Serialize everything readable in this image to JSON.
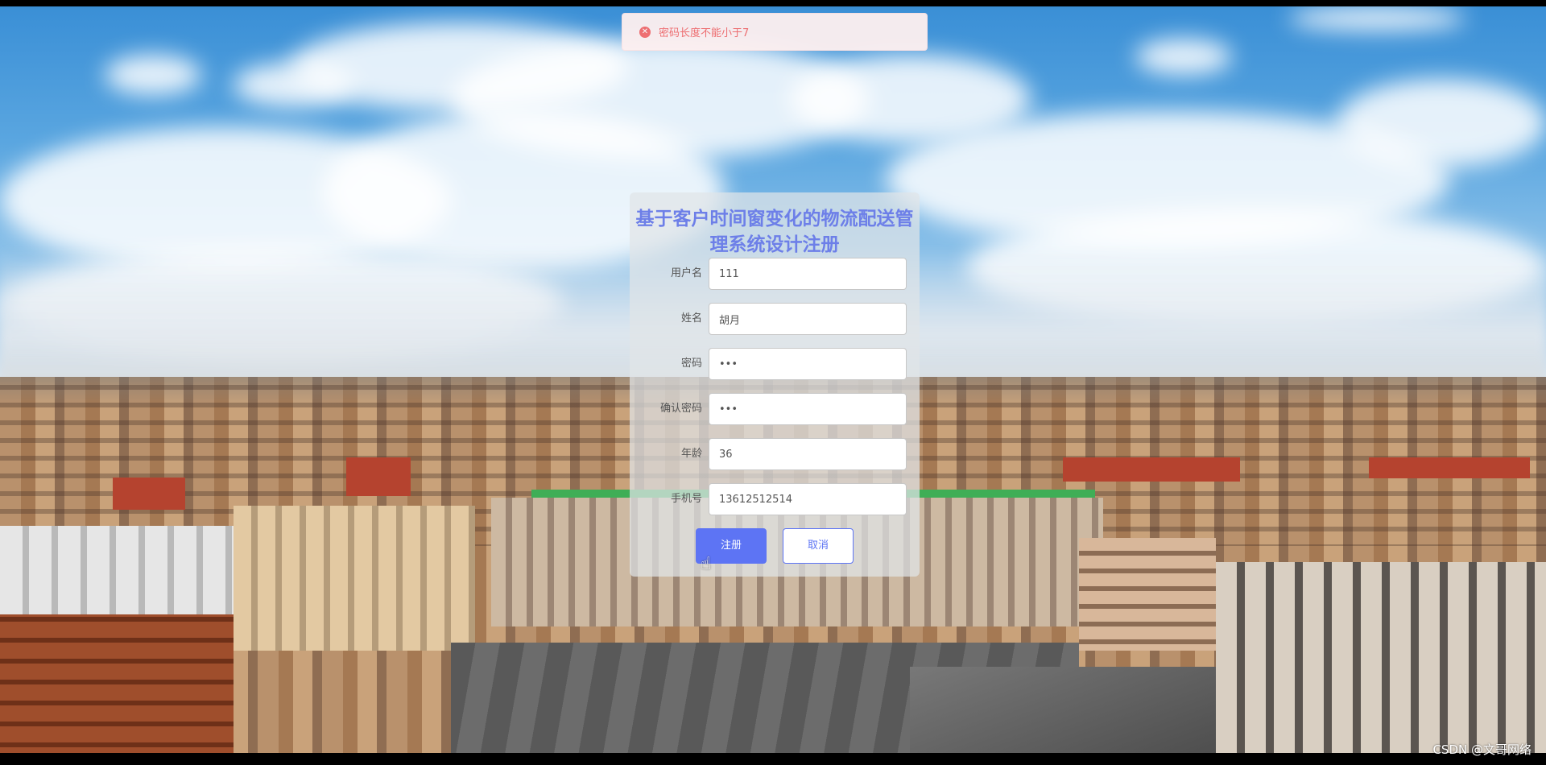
{
  "toast": {
    "icon": "error-circle-icon",
    "message": "密码长度不能小于7",
    "color": "#f56c6c"
  },
  "register": {
    "title": "基于客户时间窗变化的物流配送管理系统设计注册",
    "fields": [
      {
        "label": "用户名",
        "value": "111"
      },
      {
        "label": "姓名",
        "value": "胡月"
      },
      {
        "label": "密码",
        "value": "•••"
      },
      {
        "label": "确认密码",
        "value": "•••"
      },
      {
        "label": "年龄",
        "value": "36"
      },
      {
        "label": "手机号",
        "value": "13612512514"
      }
    ],
    "submit_label": "注册",
    "cancel_label": "取消",
    "accent": "#5d74f4"
  },
  "watermark": "CSDN @文哥网络"
}
